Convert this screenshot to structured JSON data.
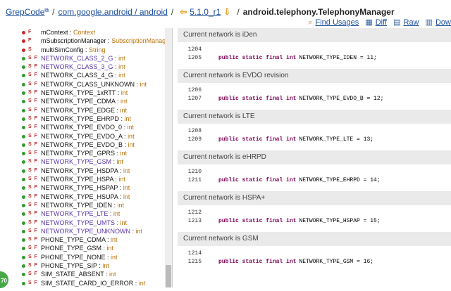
{
  "header": {
    "site": "GrepCode",
    "package": "com.google.android / android",
    "version": "5.1.0_r1",
    "class_name": "android.telephony.TelephonyManager"
  },
  "actions": [
    {
      "label": "Find Usages",
      "icon": "find-usages-icon"
    },
    {
      "label": "Diff",
      "icon": "diff-icon"
    },
    {
      "label": "Raw",
      "icon": "raw-icon"
    },
    {
      "label": "Dow",
      "icon": "download-icon"
    }
  ],
  "members": [
    {
      "dot": "red",
      "mod": "F",
      "name": "mContext",
      "type": "Context",
      "purple": false
    },
    {
      "dot": "red",
      "mod": "F",
      "name": "mSubscriptionManager",
      "type": "SubscriptionManager",
      "purple": false
    },
    {
      "dot": "red",
      "mod": "S",
      "name": "multiSimConfig",
      "type": "String",
      "purple": false
    },
    {
      "dot": "green",
      "mod": "S F",
      "name": "NETWORK_CLASS_2_G",
      "type": "int",
      "purple": true
    },
    {
      "dot": "green",
      "mod": "S F",
      "name": "NETWORK_CLASS_3_G",
      "type": "int",
      "purple": true
    },
    {
      "dot": "green",
      "mod": "S F",
      "name": "NETWORK_CLASS_4_G",
      "type": "int",
      "purple": false
    },
    {
      "dot": "green",
      "mod": "S F",
      "name": "NETWORK_CLASS_UNKNOWN",
      "type": "int",
      "purple": false
    },
    {
      "dot": "green",
      "mod": "S F",
      "name": "NETWORK_TYPE_1xRTT",
      "type": "int",
      "purple": false
    },
    {
      "dot": "green",
      "mod": "S F",
      "name": "NETWORK_TYPE_CDMA",
      "type": "int",
      "purple": false
    },
    {
      "dot": "green",
      "mod": "S F",
      "name": "NETWORK_TYPE_EDGE",
      "type": "int",
      "purple": false
    },
    {
      "dot": "green",
      "mod": "S F",
      "name": "NETWORK_TYPE_EHRPD",
      "type": "int",
      "purple": false
    },
    {
      "dot": "green",
      "mod": "S F",
      "name": "NETWORK_TYPE_EVDO_0",
      "type": "int",
      "purple": false
    },
    {
      "dot": "green",
      "mod": "S F",
      "name": "NETWORK_TYPE_EVDO_A",
      "type": "int",
      "purple": false
    },
    {
      "dot": "green",
      "mod": "S F",
      "name": "NETWORK_TYPE_EVDO_B",
      "type": "int",
      "purple": false
    },
    {
      "dot": "green",
      "mod": "S F",
      "name": "NETWORK_TYPE_GPRS",
      "type": "int",
      "purple": false
    },
    {
      "dot": "green",
      "mod": "S F",
      "name": "NETWORK_TYPE_GSM",
      "type": "int",
      "purple": true
    },
    {
      "dot": "green",
      "mod": "S F",
      "name": "NETWORK_TYPE_HSDPA",
      "type": "int",
      "purple": false
    },
    {
      "dot": "green",
      "mod": "S F",
      "name": "NETWORK_TYPE_HSPA",
      "type": "int",
      "purple": false
    },
    {
      "dot": "green",
      "mod": "S F",
      "name": "NETWORK_TYPE_HSPAP",
      "type": "int",
      "purple": false
    },
    {
      "dot": "green",
      "mod": "S F",
      "name": "NETWORK_TYPE_HSUPA",
      "type": "int",
      "purple": false
    },
    {
      "dot": "green",
      "mod": "S F",
      "name": "NETWORK_TYPE_IDEN",
      "type": "int",
      "purple": false
    },
    {
      "dot": "green",
      "mod": "S F",
      "name": "NETWORK_TYPE_LTE",
      "type": "int",
      "purple": true
    },
    {
      "dot": "green",
      "mod": "S F",
      "name": "NETWORK_TYPE_UMTS",
      "type": "int",
      "purple": true
    },
    {
      "dot": "green",
      "mod": "S F",
      "name": "NETWORK_TYPE_UNKNOWN",
      "type": "int",
      "purple": true
    },
    {
      "dot": "green",
      "mod": "S F",
      "name": "PHONE_TYPE_CDMA",
      "type": "int",
      "purple": false
    },
    {
      "dot": "green",
      "mod": "S F",
      "name": "PHONE_TYPE_GSM",
      "type": "int",
      "purple": false
    },
    {
      "dot": "green",
      "mod": "S F",
      "name": "PHONE_TYPE_NONE",
      "type": "int",
      "purple": false
    },
    {
      "dot": "green",
      "mod": "S F",
      "name": "PHONE_TYPE_SIP",
      "type": "int",
      "purple": false
    },
    {
      "dot": "green",
      "mod": "S F",
      "name": "SIM_STATE_ABSENT",
      "type": "int",
      "purple": false
    },
    {
      "dot": "green",
      "mod": "S F",
      "name": "SIM_STATE_CARD_IO_ERROR",
      "type": "int",
      "purple": false
    }
  ],
  "badge": "70",
  "sections": [
    {
      "comment": "Current network is iDen",
      "lines": [
        {
          "no": "1204",
          "kw": "",
          "text": ""
        },
        {
          "no": "1205",
          "kw": "public static final int",
          "text": "NETWORK_TYPE_IDEN = 11;"
        }
      ]
    },
    {
      "comment": "Current network is EVDO revision",
      "lines": [
        {
          "no": "1206",
          "kw": "",
          "text": ""
        },
        {
          "no": "1207",
          "kw": "public static final int",
          "text": "NETWORK_TYPE_EVDO_B = 12;"
        }
      ]
    },
    {
      "comment": "Current network is LTE",
      "lines": [
        {
          "no": "1208",
          "kw": "",
          "text": ""
        },
        {
          "no": "1209",
          "kw": "public static final int",
          "text": "NETWORK_TYPE_LTE = 13;"
        }
      ]
    },
    {
      "comment": "Current network is eHRPD",
      "lines": [
        {
          "no": "1210",
          "kw": "",
          "text": ""
        },
        {
          "no": "1211",
          "kw": "public static final int",
          "text": "NETWORK_TYPE_EHRPD = 14;"
        }
      ]
    },
    {
      "comment": "Current network is HSPA+",
      "lines": [
        {
          "no": "1212",
          "kw": "",
          "text": ""
        },
        {
          "no": "1213",
          "kw": "public static final int",
          "text": "NETWORK_TYPE_HSPAP = 15;"
        }
      ]
    },
    {
      "comment": "Current network is GSM",
      "lines": [
        {
          "no": "1214",
          "kw": "",
          "text": ""
        },
        {
          "no": "1215",
          "kw": "public static final int",
          "text": "NETWORK_TYPE_GSM = 16;"
        }
      ]
    }
  ]
}
